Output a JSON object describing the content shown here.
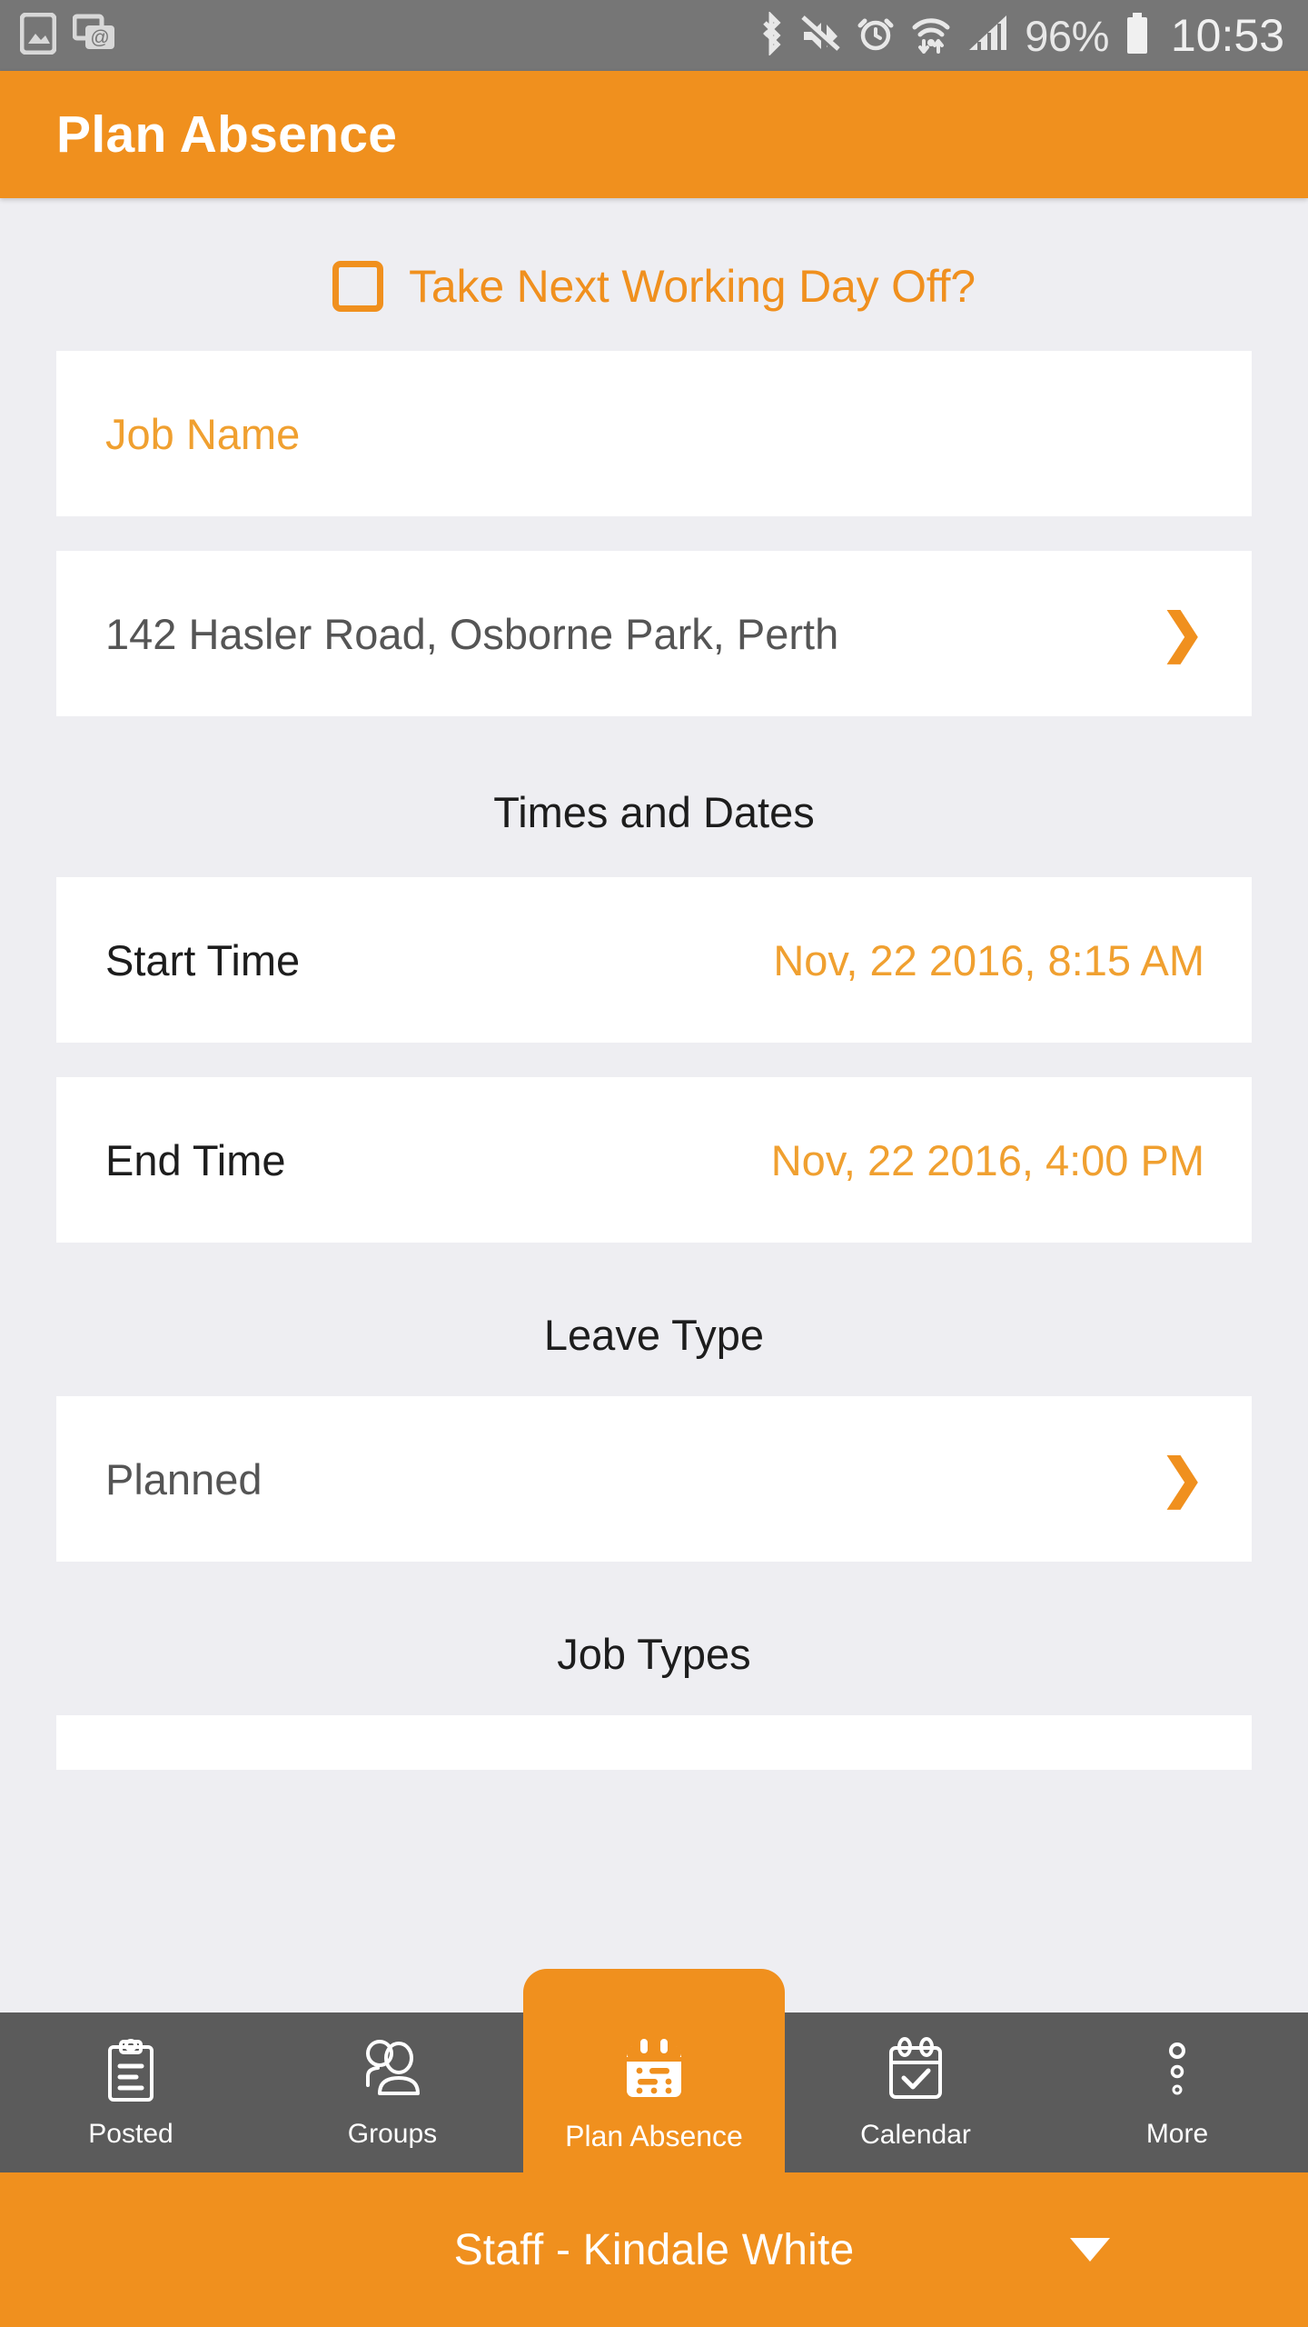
{
  "status_bar": {
    "left_icons": [
      "screenshot-image-icon",
      "email-card-icon"
    ],
    "right_icons": [
      "bluetooth-icon",
      "volume-mute-icon",
      "alarm-clock-icon",
      "wifi-icon",
      "cellular-signal-icon"
    ],
    "battery_percent": "96%",
    "time": "10:53",
    "background_color": "#767676"
  },
  "app_bar": {
    "title": "Plan Absence",
    "background_color": "#F0901E"
  },
  "form": {
    "take_next_day_off": {
      "label": "Take Next Working Day Off?",
      "checked": false
    },
    "job_name": {
      "placeholder": "Job Name",
      "value": ""
    },
    "address": {
      "value": "142 Hasler Road, Osborne Park, Perth",
      "chevron": "❯"
    },
    "times_and_dates_header": "Times and Dates",
    "start_time": {
      "label": "Start Time",
      "value": "Nov, 22 2016, 8:15 AM"
    },
    "end_time": {
      "label": "End Time",
      "value": "Nov, 22 2016, 4:00 PM"
    },
    "leave_type_header": "Leave Type",
    "leave_type": {
      "value": "Planned",
      "chevron": "❯"
    },
    "job_types_header": "Job Types"
  },
  "bottom_nav": {
    "items": [
      {
        "label": "Posted",
        "icon": "clipboard-icon",
        "active": false
      },
      {
        "label": "Groups",
        "icon": "people-group-icon",
        "active": false
      },
      {
        "label": "Plan Absence",
        "icon": "calendar-plan-icon",
        "active": true
      },
      {
        "label": "Calendar",
        "icon": "calendar-check-icon",
        "active": false
      },
      {
        "label": "More",
        "icon": "three-dots-icon",
        "active": false
      }
    ],
    "background_color": "#5B5B5B",
    "active_color": "#F0901E"
  },
  "footer": {
    "label": "Staff - Kindale White",
    "caret": "▼",
    "background_color": "#F0901E"
  },
  "colors": {
    "accent_orange": "#F0901E",
    "page_background": "#EEEEF2",
    "card_white": "#FFFFFF",
    "text_dark": "#1D1D1D",
    "text_gray": "#555555"
  }
}
